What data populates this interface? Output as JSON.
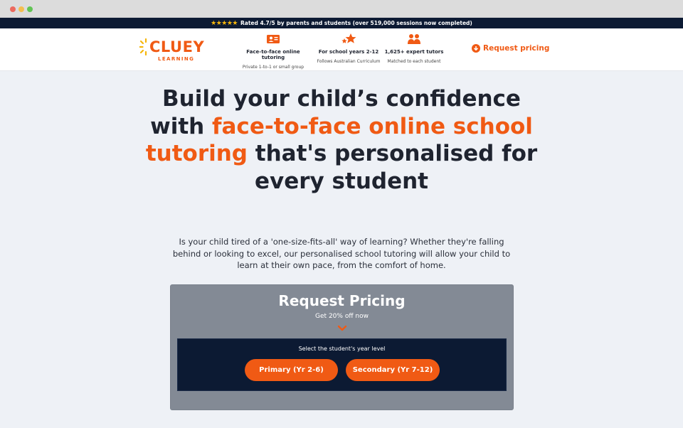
{
  "rating_bar": {
    "stars": "★★★★★",
    "text": "Rated 4.7/5 by parents and students (over 519,000 sessions now completed)"
  },
  "header": {
    "logo_word": "CLUEY",
    "logo_sub": "LEARNING",
    "features": [
      {
        "icon": "face-to-face-icon",
        "title": "Face-to-face online tutoring",
        "subtitle": "Private 1-to-1 or small group"
      },
      {
        "icon": "stars-icon",
        "title": "For school years 2-12",
        "subtitle": "Follows Australian Curriculum"
      },
      {
        "icon": "tutors-icon",
        "title": "1,625+ expert tutors",
        "subtitle": "Matched to each student"
      }
    ],
    "request_link": "Request pricing"
  },
  "hero": {
    "title_part1": "Build your child’s confidence with ",
    "title_accent": "face-to-face online school tutoring",
    "title_part2": " that's personalised for every student",
    "description": "Is your child tired of a 'one-size-fits-all' way of learning? Whether they're falling behind or looking to excel, our personalised school tutoring will allow your child to learn at their own pace, from the comfort of home."
  },
  "pricing_panel": {
    "title": "Request Pricing",
    "subtitle": "Get 20% off now",
    "instruction": "Select the student's year level",
    "primary_button": "Primary (Yr 2-6)",
    "secondary_button": "Secondary (Yr 7-12)"
  },
  "colors": {
    "accent": "#f05a14",
    "navy": "#0c1a33",
    "star": "#f5b60c",
    "panel_gray": "#838a95",
    "page_bg": "#eef1f6"
  }
}
